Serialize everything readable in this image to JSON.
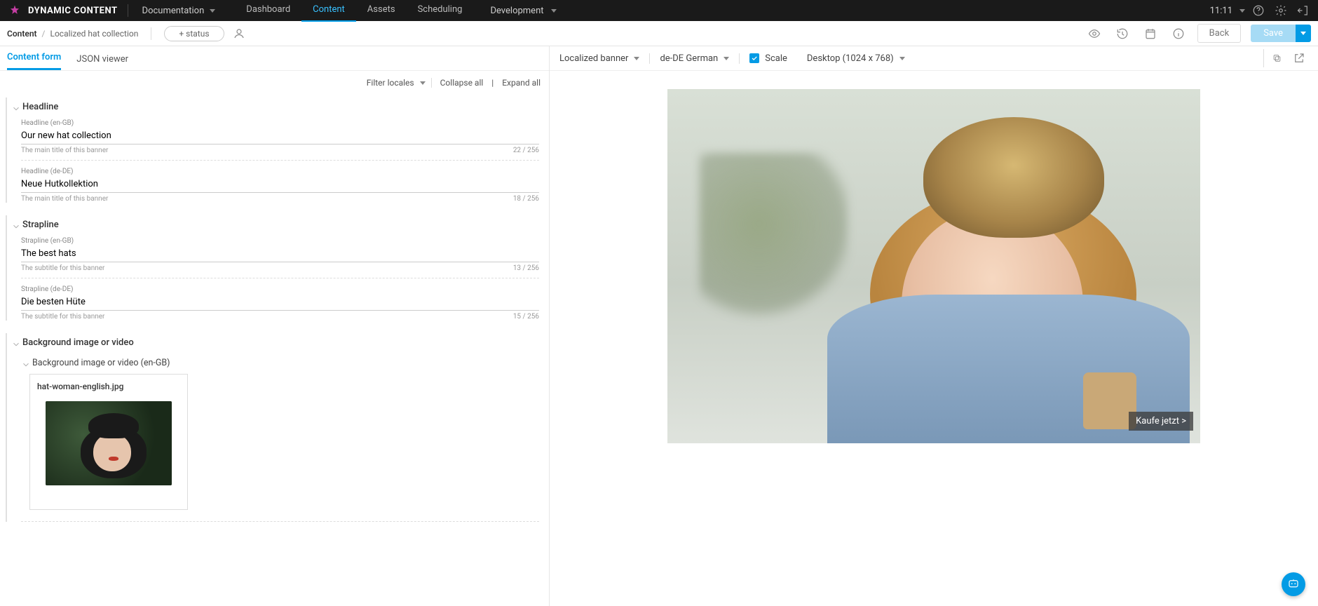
{
  "brand": "DYNAMIC CONTENT",
  "doc_dropdown": "Documentation",
  "topnav": {
    "dashboard": "Dashboard",
    "content": "Content",
    "assets": "Assets",
    "scheduling": "Scheduling"
  },
  "environment": "Development",
  "clock": "11:11",
  "breadcrumb": {
    "root": "Content",
    "sep": "/",
    "current": "Localized hat collection"
  },
  "status_button": "+ status",
  "back_button": "Back",
  "save_button": "Save",
  "tabs": {
    "form": "Content form",
    "json": "JSON viewer"
  },
  "form_toolbar": {
    "filter": "Filter locales",
    "collapse": "Collapse all",
    "sep": "|",
    "expand": "Expand all"
  },
  "groups": {
    "headline": {
      "title": "Headline",
      "en": {
        "label": "Headline (en-GB)",
        "value": "Our new hat collection",
        "help": "The main title of this banner",
        "count": "22 / 256"
      },
      "de": {
        "label": "Headline (de-DE)",
        "value": "Neue Hutkollektion",
        "help": "The main title of this banner",
        "count": "18 / 256"
      }
    },
    "strapline": {
      "title": "Strapline",
      "en": {
        "label": "Strapline (en-GB)",
        "value": "The best hats",
        "help": "The subtitle for this banner",
        "count": "13 / 256"
      },
      "de": {
        "label": "Strapline (de-DE)",
        "value": "Die besten Hüte",
        "help": "The subtitle for this banner",
        "count": "15 / 256"
      }
    },
    "bg": {
      "title": "Background image or video",
      "en": {
        "title": "Background image or video (en-GB)",
        "filename": "hat-woman-english.jpg"
      }
    }
  },
  "preview_bar": {
    "visualization": "Localized banner",
    "locale": "de-DE German",
    "scale_label": "Scale",
    "device": "Desktop (1024 x 768)"
  },
  "preview": {
    "cta": "Kaufe jetzt >"
  }
}
